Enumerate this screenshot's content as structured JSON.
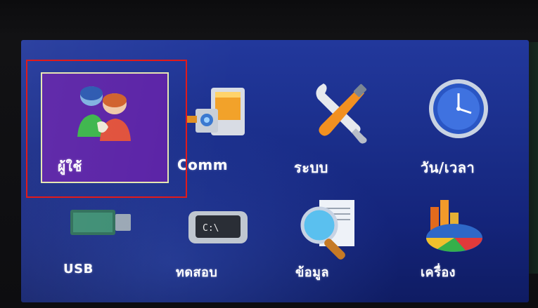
{
  "menu": {
    "items": [
      {
        "label": "ผู้ใช้",
        "icon": "users-icon",
        "selected": true
      },
      {
        "label": "Comm",
        "icon": "communication-icon"
      },
      {
        "label": "ระบบ",
        "icon": "system-tools-icon"
      },
      {
        "label": "วัน/เวลา",
        "icon": "clock-icon"
      },
      {
        "label": "USB",
        "icon": "usb-drive-icon"
      },
      {
        "label": "ทดสอบ",
        "icon": "test-chip-icon"
      },
      {
        "label": "ข้อมูล",
        "icon": "data-search-icon"
      },
      {
        "label": "เครื่อง",
        "icon": "pie-chart-icon"
      }
    ]
  },
  "colors": {
    "screen": "#1b2f8c",
    "selection_fill": "#5a22a6",
    "selection_border": "#e6e6b0",
    "highlight_frame": "#e21a1a"
  }
}
